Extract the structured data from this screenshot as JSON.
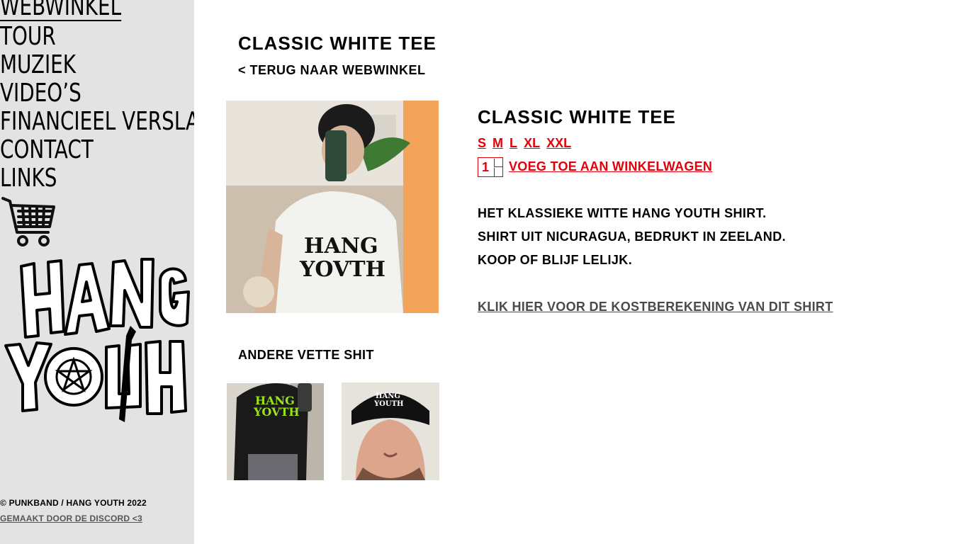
{
  "nav": {
    "items": [
      {
        "label": "WEBWINKEL",
        "active": true
      },
      {
        "label": "TOUR"
      },
      {
        "label": "MUZIEK"
      },
      {
        "label": "VIDEO’S"
      },
      {
        "label": "FINANCIEEL VERSLAG"
      },
      {
        "label": "CONTACT"
      },
      {
        "label": "LINKS"
      }
    ],
    "cart_icon": "shopping-cart-icon",
    "logo_icon": "hang-youth-logo"
  },
  "footer": {
    "copyright": "© PUNKBAND / HANG YOUTH 2022",
    "credit": "GEMAAKT DOOR DE DISCORD <3"
  },
  "page": {
    "title": "CLASSIC WHITE TEE",
    "back_link": "< TERUG NAAR WEBWINKEL"
  },
  "product": {
    "name": "CLASSIC WHITE TEE",
    "sizes": [
      "S",
      "M",
      "L",
      "XL",
      "XXL"
    ],
    "quantity": "1",
    "add_to_cart": "VOEG TOE AAN WINKELWAGEN",
    "description": [
      "HET KLASSIEKE WITTE HANG YOUTH SHIRT.",
      "SHIRT UIT NICURAGUA, BEDRUKT IN ZEELAND.",
      "KOOP OF BLIJF LELIJK."
    ],
    "cost_link": "KLIK HIER VOOR DE KOSTBEREKENING VAN DIT SHIRT"
  },
  "related": {
    "heading": "ANDERE VETTE SHIT"
  },
  "colors": {
    "accent": "#e4000a",
    "sidebar_bg": "#e3e3e3",
    "muted_link": "#4a4a4a"
  }
}
